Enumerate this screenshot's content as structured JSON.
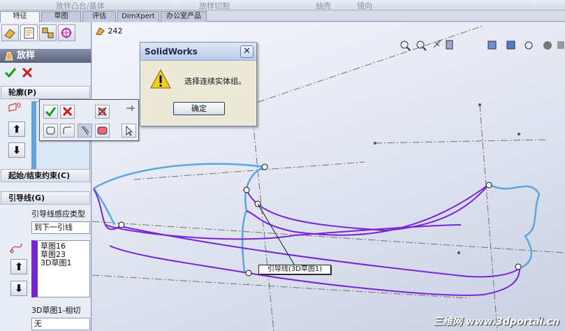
{
  "topbar": {
    "item1": "放样凸台/基体",
    "item2": "放样切割",
    "item3": "抽壳",
    "item4": "镜向"
  },
  "tabs": [
    "特征",
    "草图",
    "评估",
    "DimXpert",
    "办公室产品"
  ],
  "tree": {
    "part_label": "242"
  },
  "feature": {
    "title": "放样",
    "ok_icon": "check-icon",
    "cancel_icon": "x-icon"
  },
  "sections": {
    "profiles": "轮廓(P)",
    "constraints": "起始/结束约束(C)",
    "guides": "引导线(G)"
  },
  "guides": {
    "influence_label": "引导线感应类型",
    "influence_value": "到下一引线",
    "items": [
      "草图16",
      "草图23",
      "3D草图1"
    ],
    "tangency_label": "3D草图1-相切",
    "tangency_value": "无"
  },
  "dialog": {
    "title": "SolidWorks",
    "message": "选择连续实体组。",
    "ok_button": "确定",
    "icon": "warning-icon"
  },
  "callout": {
    "label": "引导线(3D草图1)"
  },
  "watermark": "三维网 www.3dportal.cn",
  "colors": {
    "guide_curve": "#7a22d8",
    "profile_curve": "#5aa6e0",
    "panel_bg": "#e8ecf4",
    "dialog_bg": "#ece9d8"
  }
}
